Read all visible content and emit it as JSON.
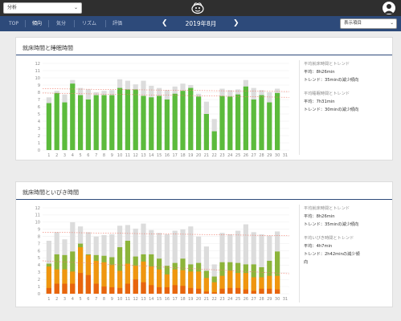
{
  "header": {
    "select_value": "分析",
    "logo": "logo-icon",
    "avatar": "avatar-icon"
  },
  "nav": {
    "tabs": [
      "TOP",
      "傾向",
      "気分",
      "リズム",
      "評価"
    ],
    "active_tab": "傾向",
    "prev": "❮",
    "next": "❯",
    "month": "2019年8月",
    "display_select": "表示項目"
  },
  "colors": {
    "nav_bg": "#2d4a7a",
    "green": "#5cbb3c",
    "gray_bar": "#dcdcdc",
    "olive": "#8cb43a",
    "orange": "#f0960f",
    "dark_orange": "#e8650e",
    "trend": "#f07a6a"
  },
  "panel1": {
    "title": "就床時間と睡眠時間",
    "info": [
      {
        "label": "平均就床時間とトレンド",
        "avg": "平均：8h26min",
        "trend": "トレンド：35minの減少傾向"
      },
      {
        "label": "平均睡眠時間とトレンド",
        "avg": "平均：7h31min",
        "trend": "トレンド：30minの減少傾向"
      }
    ]
  },
  "panel2": {
    "title": "就床時間といびき時間",
    "info": [
      {
        "label": "平均就床時間とトレンド",
        "avg": "平均：8h26min",
        "trend": "トレンド：35minの減少傾向"
      },
      {
        "label": "平均いびき時間とトレンド",
        "avg": "平均：4h7min",
        "trend": "トレンド：2h42minの減少傾",
        "trend2": "向"
      }
    ]
  },
  "chart_data": [
    {
      "type": "bar",
      "categories": [
        "1",
        "2",
        "3",
        "4",
        "5",
        "6",
        "7",
        "8",
        "9",
        "10",
        "11",
        "12",
        "13",
        "14",
        "15",
        "16",
        "17",
        "18",
        "19",
        "20",
        "21",
        "22",
        "23",
        "24",
        "25",
        "26",
        "27",
        "28",
        "29",
        "30",
        "31"
      ],
      "ylim": [
        0,
        12
      ],
      "yticks": [
        0,
        1,
        2,
        3,
        4,
        5,
        6,
        7,
        8,
        9,
        10,
        11,
        12
      ],
      "series": [
        {
          "values": [
            7.3,
            8.2,
            7.7,
            9.7,
            8.6,
            8.4,
            8.0,
            8.2,
            8.3,
            9.8,
            9.6,
            9.1,
            9.6,
            8.9,
            8.6,
            8.3,
            8.8,
            9.2,
            9.0,
            7.8,
            6.7,
            4.3,
            8.5,
            8.3,
            8.4,
            9.7,
            8.6,
            8.3,
            8.0,
            8.5,
            0
          ]
        },
        {
          "values": [
            6.5,
            7.9,
            6.6,
            9.2,
            7.6,
            7.0,
            7.6,
            7.6,
            7.6,
            8.6,
            8.4,
            8.4,
            7.5,
            7.3,
            7.5,
            7.0,
            7.8,
            8.2,
            8.6,
            7.4,
            5.0,
            2.6,
            7.5,
            7.4,
            7.7,
            8.8,
            7.0,
            7.6,
            6.6,
            7.9,
            0
          ]
        }
      ],
      "trends": [
        {
          "start": 8.5,
          "end": 8.1
        },
        {
          "start": 7.9,
          "end": 7.3
        }
      ]
    },
    {
      "type": "bar",
      "categories": [
        "1",
        "2",
        "3",
        "4",
        "5",
        "6",
        "7",
        "8",
        "9",
        "10",
        "11",
        "12",
        "13",
        "14",
        "15",
        "16",
        "17",
        "18",
        "19",
        "20",
        "21",
        "22",
        "23",
        "24",
        "25",
        "26",
        "27",
        "28",
        "29",
        "30",
        "31"
      ],
      "ylim": [
        0,
        12
      ],
      "yticks": [
        0,
        1,
        2,
        3,
        4,
        5,
        6,
        7,
        8,
        9,
        10,
        11,
        12
      ],
      "series": [
        {
          "values": [
            7.4,
            8.6,
            7.6,
            10.0,
            9.4,
            8.6,
            8.0,
            8.2,
            8.3,
            9.5,
            9.6,
            9.1,
            9.8,
            8.9,
            8.5,
            8.3,
            8.8,
            9.0,
            9.4,
            8.0,
            6.6,
            4.1,
            8.5,
            8.3,
            8.8,
            9.7,
            8.6,
            8.3,
            8.1,
            8.7,
            0
          ]
        },
        {
          "values": [
            4.2,
            5.5,
            5.4,
            5.9,
            7.0,
            5.5,
            5.4,
            5.3,
            5.1,
            6.5,
            7.4,
            5.2,
            5.5,
            5.5,
            4.9,
            3.9,
            4.3,
            4.9,
            4.1,
            4.3,
            3.2,
            2.4,
            4.4,
            4.4,
            4.3,
            4.1,
            4.1,
            3.7,
            4.6,
            5.9,
            0
          ]
        },
        {
          "values": [
            3.8,
            3.4,
            3.4,
            3.1,
            6.5,
            5.4,
            4.6,
            4.4,
            4.0,
            3.2,
            4.2,
            3.9,
            4.5,
            3.8,
            3.4,
            2.7,
            3.4,
            3.3,
            3.1,
            3.1,
            2.2,
            1.6,
            2.5,
            3.2,
            2.9,
            2.9,
            2.3,
            2.3,
            2.5,
            2.5,
            0
          ]
        },
        {
          "values": [
            0.8,
            1.4,
            1.4,
            1.4,
            2.9,
            2.6,
            1.4,
            1.0,
            0.9,
            0.8,
            1.4,
            2.0,
            1.6,
            1.2,
            0.9,
            0.9,
            1.2,
            1.1,
            0.8,
            0.7,
            0.3,
            0.2,
            0.7,
            0.8,
            0.8,
            0.6,
            0.4,
            0.7,
            0.7,
            0.6,
            0
          ]
        }
      ],
      "trends": [
        {
          "start": 8.6,
          "end": 8.1
        },
        {
          "start": 4.6,
          "end": 2.8
        }
      ]
    }
  ]
}
